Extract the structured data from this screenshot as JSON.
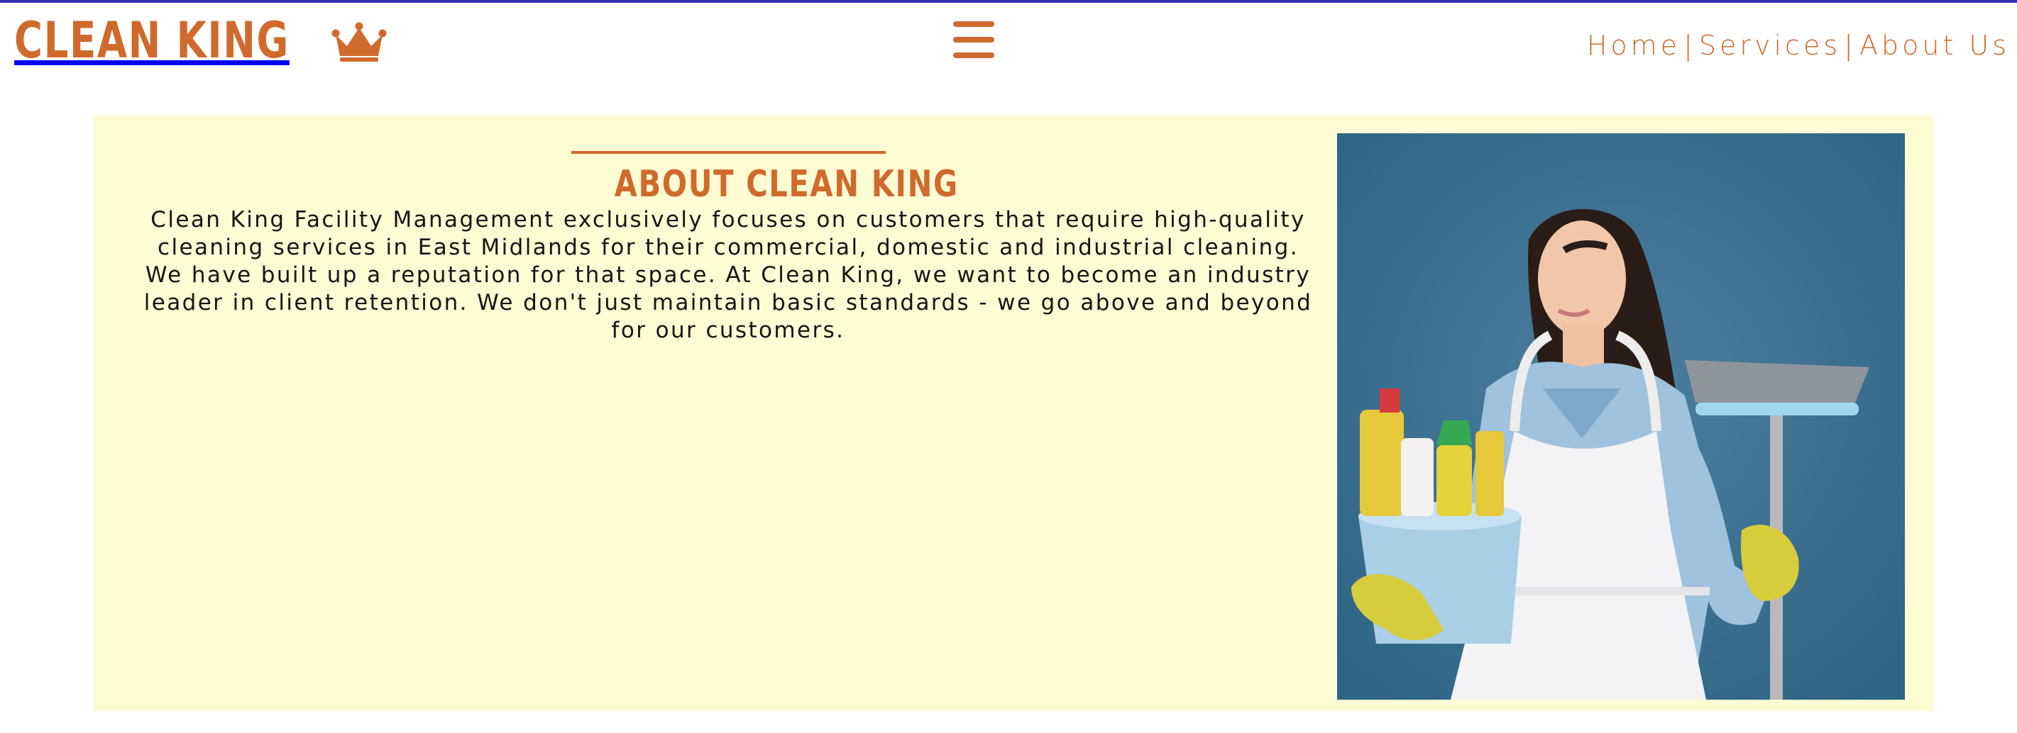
{
  "brand": {
    "name": "CLEAN KING",
    "icon": "crown-icon",
    "color": "#d06a2c"
  },
  "header": {
    "menu_icon": "hamburger-menu-icon",
    "nav": [
      {
        "label": "Home"
      },
      {
        "label": "Services"
      },
      {
        "label": "About Us"
      }
    ],
    "separator": "|"
  },
  "about": {
    "title": "ABOUT CLEAN KING",
    "text": "Clean King Facility Management exclusively focuses on customers that require high-quality cleaning services in East Midlands for their commercial, domestic and industrial cleaning. We have built up a reputation for that space. At Clean King, we want to become an industry leader in client retention. We don't just maintain basic standards - we go above and beyond for our customers.",
    "background_color": "#fffbd3",
    "image": "woman-holding-cleaning-supplies-and-broom-photo"
  },
  "colors": {
    "accent": "#d06a2c",
    "top_border": "#3b2fb5",
    "panel": "#fffbd3"
  }
}
